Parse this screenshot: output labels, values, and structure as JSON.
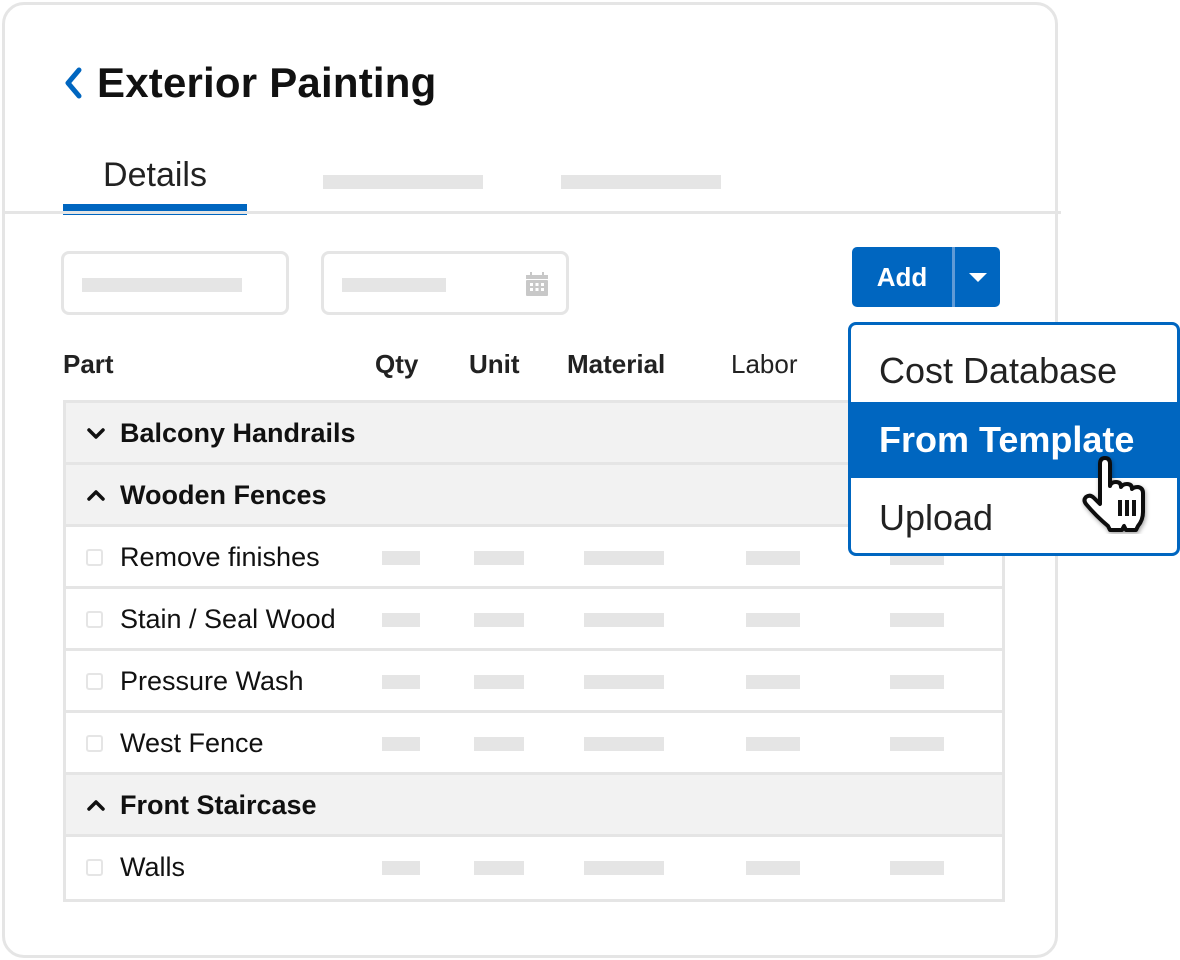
{
  "header": {
    "title": "Exterior Painting",
    "back_icon": "chevron-left-icon"
  },
  "tabs": [
    {
      "label": "Details",
      "active": true
    },
    {
      "label": "",
      "placeholder": true
    },
    {
      "label": "",
      "placeholder": true
    }
  ],
  "filters": {
    "text_field": {
      "value": "",
      "placeholder_bar": true
    },
    "date_field": {
      "value": "",
      "icon": "calendar-icon"
    }
  },
  "add_button": {
    "label": "Add",
    "dropdown_icon": "caret-down-icon"
  },
  "dropdown_menu": {
    "items": [
      {
        "label": "Cost Database",
        "highlighted": false
      },
      {
        "label": "From Template",
        "highlighted": true
      },
      {
        "label": "Upload",
        "highlighted": false
      }
    ],
    "cursor_icon": "pointer-hand-icon"
  },
  "table": {
    "columns": [
      "Part",
      "Qty",
      "Unit",
      "Material",
      "Labor"
    ],
    "rows": [
      {
        "type": "group",
        "label": "Balcony Handrails",
        "expanded": false
      },
      {
        "type": "group",
        "label": "Wooden Fences",
        "expanded": true
      },
      {
        "type": "item",
        "label": "Remove finishes",
        "checked": false
      },
      {
        "type": "item",
        "label": "Stain / Seal Wood",
        "checked": false
      },
      {
        "type": "item",
        "label": "Pressure Wash",
        "checked": false
      },
      {
        "type": "item",
        "label": "West Fence",
        "checked": false
      },
      {
        "type": "group",
        "label": "Front Staircase",
        "expanded": true
      },
      {
        "type": "item",
        "label": "Walls",
        "checked": false
      }
    ]
  },
  "colors": {
    "accent": "#0066c0",
    "border": "#e5e5e5",
    "group_bg": "#f2f2f2",
    "placeholder": "#e5e5e5"
  }
}
